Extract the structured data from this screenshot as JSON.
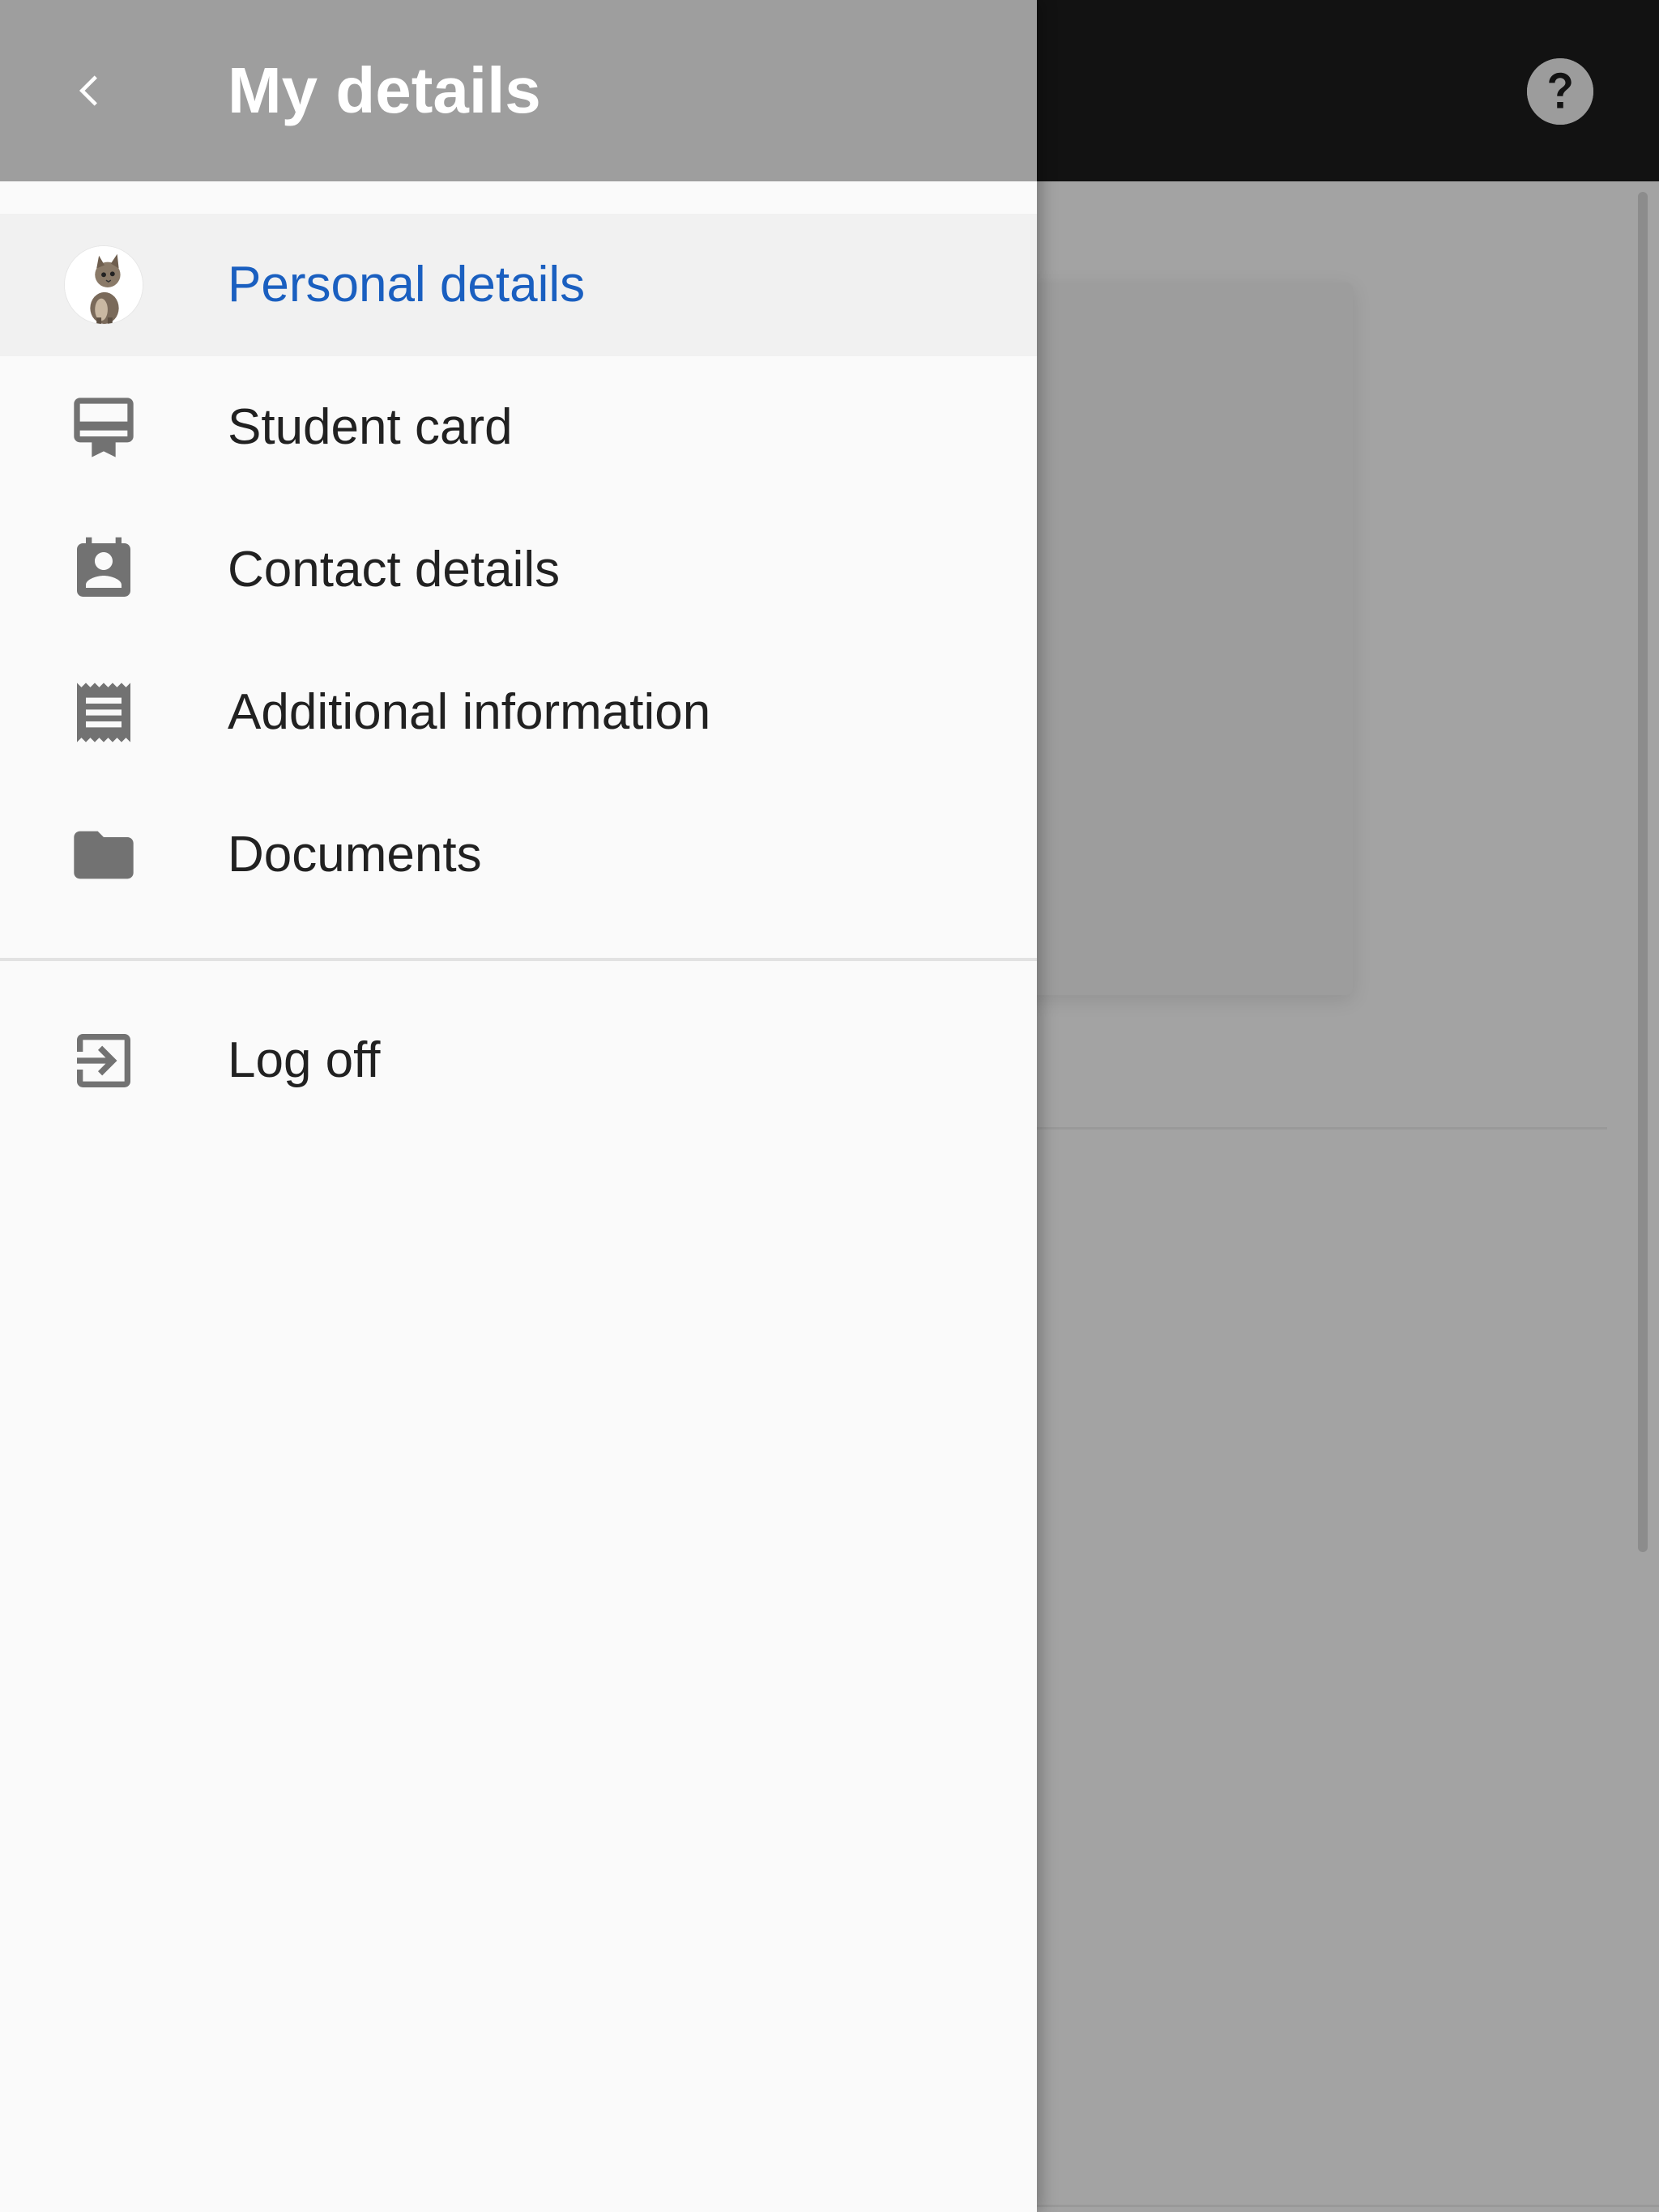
{
  "header": {
    "title": "My details"
  },
  "menu": {
    "items": [
      {
        "label": "Personal details",
        "icon": "avatar",
        "active": true
      },
      {
        "label": "Student card",
        "icon": "card-membership-icon"
      },
      {
        "label": "Contact details",
        "icon": "contact-calendar-icon"
      },
      {
        "label": "Additional information",
        "icon": "receipt-icon"
      },
      {
        "label": "Documents",
        "icon": "folder-icon"
      }
    ],
    "logout": {
      "label": "Log off",
      "icon": "exit-to-app-icon"
    }
  },
  "colors": {
    "active_text": "#1a5fc0",
    "header_bg": "#9e9e9e",
    "topbar_bg": "#121212",
    "icon_gray": "#727272"
  },
  "help": {
    "icon": "help-circle-icon"
  }
}
